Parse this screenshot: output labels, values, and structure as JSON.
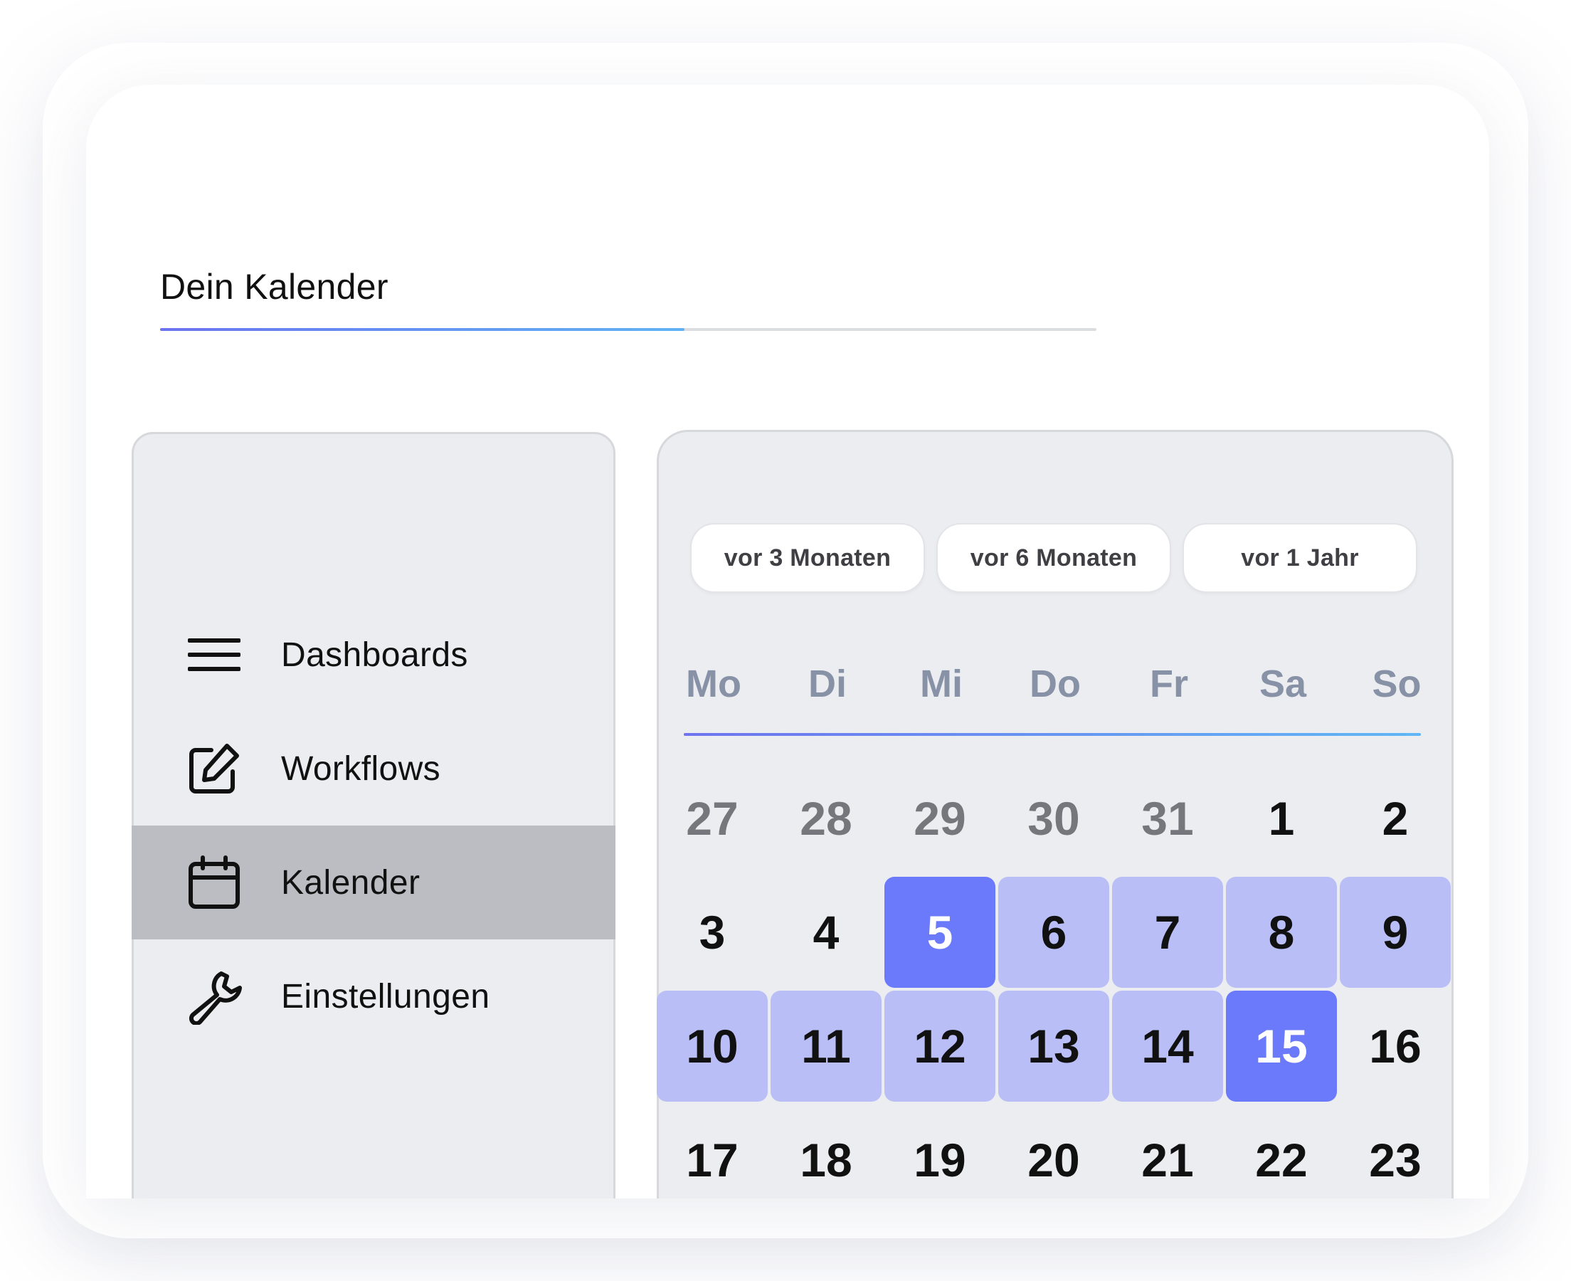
{
  "title": "Dein Kalender",
  "title_progress": 0.56,
  "colors": {
    "accent": "#6b79fb",
    "range_fill": "#b9bef7",
    "panel_bg": "#ecedf1",
    "active_nav": "#bcbdc2",
    "weekday_text": "#8892a6"
  },
  "nav": {
    "items": [
      {
        "label": "Dashboards",
        "icon": "menu-icon",
        "active": false
      },
      {
        "label": "Workflows",
        "icon": "edit-icon",
        "active": false
      },
      {
        "label": "Kalender",
        "icon": "calendar-icon",
        "active": true
      },
      {
        "label": "Einstellungen",
        "icon": "wrench-icon",
        "active": false
      }
    ]
  },
  "calendar": {
    "ranges": [
      "vor 3 Monaten",
      "vor 6 Monaten",
      "vor 1 Jahr"
    ],
    "weekdays": [
      "Mo",
      "Di",
      "Mi",
      "Do",
      "Fr",
      "Sa",
      "So"
    ],
    "weeks": [
      [
        {
          "d": "27",
          "state": "muted"
        },
        {
          "d": "28",
          "state": "muted"
        },
        {
          "d": "29",
          "state": "muted"
        },
        {
          "d": "30",
          "state": "muted"
        },
        {
          "d": "31",
          "state": "muted"
        },
        {
          "d": "1",
          "state": "normal"
        },
        {
          "d": "2",
          "state": "normal"
        }
      ],
      [
        {
          "d": "3",
          "state": "normal"
        },
        {
          "d": "4",
          "state": "normal"
        },
        {
          "d": "5",
          "state": "edge"
        },
        {
          "d": "6",
          "state": "range"
        },
        {
          "d": "7",
          "state": "range"
        },
        {
          "d": "8",
          "state": "range"
        },
        {
          "d": "9",
          "state": "range"
        }
      ],
      [
        {
          "d": "10",
          "state": "range"
        },
        {
          "d": "11",
          "state": "range"
        },
        {
          "d": "12",
          "state": "range"
        },
        {
          "d": "13",
          "state": "range"
        },
        {
          "d": "14",
          "state": "range"
        },
        {
          "d": "15",
          "state": "edge"
        },
        {
          "d": "16",
          "state": "normal"
        }
      ],
      [
        {
          "d": "17",
          "state": "normal"
        },
        {
          "d": "18",
          "state": "normal"
        },
        {
          "d": "19",
          "state": "normal"
        },
        {
          "d": "20",
          "state": "normal"
        },
        {
          "d": "21",
          "state": "normal"
        },
        {
          "d": "22",
          "state": "normal"
        },
        {
          "d": "23",
          "state": "normal"
        }
      ]
    ]
  }
}
